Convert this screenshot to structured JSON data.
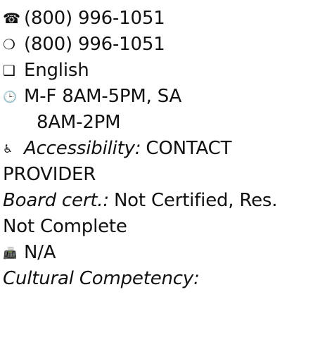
{
  "contact": {
    "phone_icon": "telephone-icon",
    "phone": "(800) 996-1051",
    "alt_icon": "circle-icon",
    "alt_phone": "(800) 996-1051",
    "lang_icon": "checkbox-icon",
    "language": "English",
    "hours_icon": "clock-icon",
    "hours_line1": "M-F 8AM-5PM, SA",
    "hours_line2": "8AM-2PM",
    "access_icon": "wheelchair-icon",
    "accessibility_label": "Accessibility:",
    "accessibility_value_1": "CONTACT",
    "accessibility_value_2": "PROVIDER",
    "board_label": "Board cert.:",
    "board_value_1": "Not Certified, Res.",
    "board_value_2": "Not Complete",
    "fax_icon": "fax-icon",
    "fax": "N/A",
    "cultural_label": "Cultural Competency:"
  }
}
